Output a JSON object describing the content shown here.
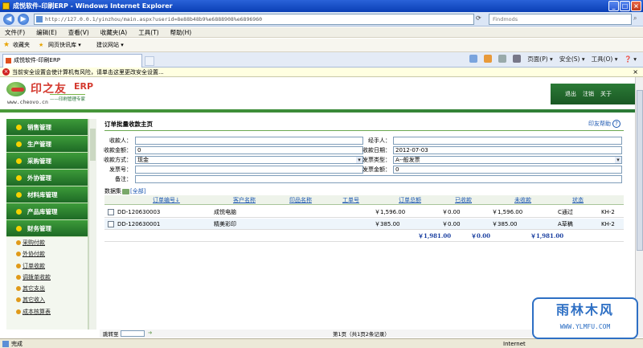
{
  "window": {
    "title": "成悦软件-印刷ERP - Windows Internet Explorer",
    "min": "_",
    "max": "□",
    "close": "×"
  },
  "address": {
    "url": "http://127.0.0.1/yinzhou/main.aspx?userid=8e88b48b9%e6888908%e6896960",
    "search_placeholder": "Findmods"
  },
  "menubar": [
    "文件(F)",
    "编辑(E)",
    "查看(V)",
    "收藏夹(A)",
    "工具(T)",
    "帮助(H)"
  ],
  "favorites": {
    "label": "收藏夹",
    "items": [
      "网页快讯库 ▾",
      "建议网站 ▾"
    ]
  },
  "tab": {
    "title": "成悦软件-印刷ERP"
  },
  "commandbar": [
    "页面(P) ▾",
    "安全(S) ▾",
    "工具(O) ▾",
    "❓ ▾"
  ],
  "infobar": {
    "text": "当前安全设置会使计算机有风险，请单击这里更改安全设置..."
  },
  "app": {
    "logo_text": "印之友",
    "logo_erp": "ERP",
    "logo_sub": "——印刷管理专家",
    "logo_url": "www.cheovo.cn",
    "header_links": [
      "退出",
      "注销",
      "关于"
    ]
  },
  "sidebar": {
    "menus": [
      "销售管理",
      "生产管理",
      "采购管理",
      "外协管理",
      "材料库管理",
      "产品库管理",
      "财务管理"
    ],
    "subitems": [
      "采购付款",
      "外协付款",
      "订单收款",
      "调拨单收款",
      "其它支出",
      "其它收入",
      "成本核算表"
    ]
  },
  "main": {
    "title": "订单批量收款主页",
    "help": "印友帮助",
    "form": {
      "payee_label": "收款人：",
      "payee_value": "",
      "handler_label": "经手人：",
      "handler_value": "",
      "amount_label": "收款金额：",
      "amount_value": "0",
      "date_label": "收款日期：",
      "date_value": "2012-07-03",
      "method_label": "收款方式：",
      "method_value": "现金",
      "invoice_type_label": "发票类型：",
      "invoice_type_value": "A--般发票",
      "invoice_no_label": "发票号：",
      "invoice_no_value": "",
      "invoice_amount_label": "发票金额：",
      "invoice_amount_value": "0",
      "remark_label": "备注：",
      "remark_value": ""
    },
    "dataset_label": "数据集",
    "dataset_all": "[全部]",
    "table": {
      "headers": [
        "订单编号↓",
        "客户名称",
        "印品名称",
        "工单号",
        "订单总额",
        "已收款",
        "未收款",
        "状态"
      ],
      "rows": [
        {
          "order_no": "DD-120630003",
          "customer": "成悦电脑",
          "product": "",
          "work_no": "",
          "total": "￥1,596.00",
          "received": "￥0.00",
          "unreceived": "￥1,596.00",
          "status": "C通过",
          "extra": "KH-2"
        },
        {
          "order_no": "DD-120630001",
          "customer": "精美彩印",
          "product": "",
          "work_no": "",
          "total": "￥385.00",
          "received": "￥0.00",
          "unreceived": "￥385.00",
          "status": "A草稿",
          "extra": "KH-2"
        }
      ],
      "totals": {
        "total": "￥1,981.00",
        "received": "￥0.00",
        "unreceived": "￥1,981.00"
      }
    },
    "pager": {
      "jump_label": "跳转至",
      "page_info": "第1页（共1页2条记录）"
    }
  },
  "status": {
    "text": "完成",
    "zone": "Internet"
  },
  "watermark": {
    "title": "雨林木风",
    "url": "WWW.YLMFU.COM"
  }
}
